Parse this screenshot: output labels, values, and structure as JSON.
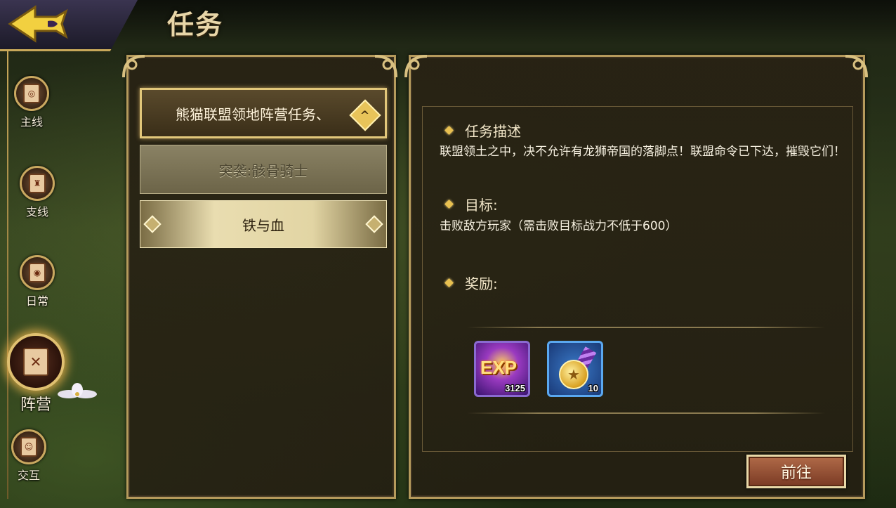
{
  "header": {
    "title": "任务",
    "back_label": ""
  },
  "sidebar": {
    "items": [
      {
        "label": "主线",
        "icon": "scroll-icon",
        "active": false
      },
      {
        "label": "支线",
        "icon": "scroll-icon",
        "active": false
      },
      {
        "label": "日常",
        "icon": "scroll-icon",
        "active": false
      },
      {
        "label": "阵营",
        "icon": "crossed-swords-icon",
        "active": true
      },
      {
        "label": "交互",
        "icon": "people-icon",
        "active": false
      }
    ]
  },
  "quest_list": {
    "header": "熊猫联盟领地阵营任务、",
    "items": [
      {
        "label": "突袭:骸骨骑士",
        "state": "disabled"
      },
      {
        "label": "铁与血",
        "state": "selected"
      }
    ]
  },
  "detail": {
    "description_heading": "任务描述",
    "description": "联盟领土之中，决不允许有龙狮帝国的落脚点！联盟命令已下达，摧毁它们！",
    "goal_heading": "目标:",
    "goal": "击败敌方玩家（需击败目标战力不低于600）",
    "reward_heading": "奖励:",
    "rewards": [
      {
        "label": "EXP",
        "count": "3125",
        "icon": "exp-icon"
      },
      {
        "label": "",
        "count": "10",
        "icon": "medal-icon"
      }
    ],
    "go_button": "前往"
  },
  "colors": {
    "gold": "#c8a85a",
    "panel": "#2a2414",
    "accent": "#e8c050"
  }
}
